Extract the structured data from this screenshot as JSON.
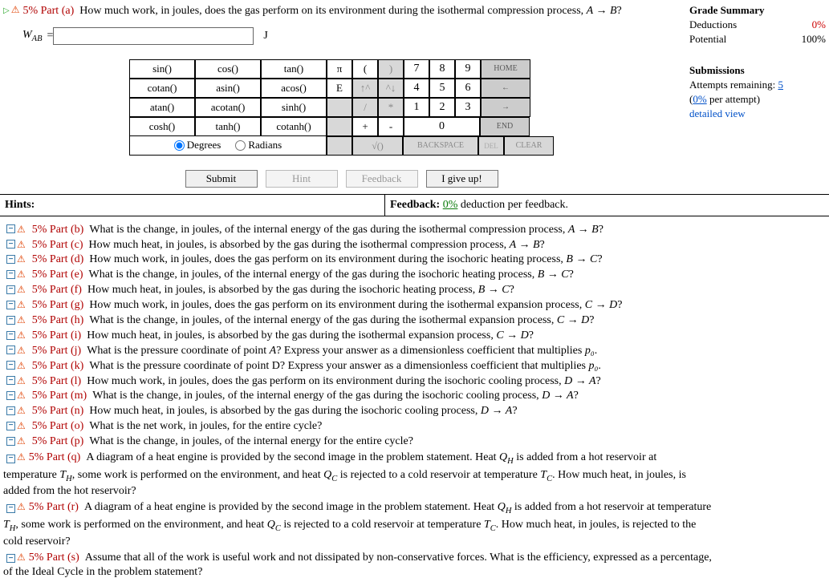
{
  "current": {
    "pct": "5%",
    "label": "Part (a)",
    "question_pre": "How much work, in joules, does the gas perform on its environment during the isothermal compression process, ",
    "process": "A → B",
    "question_post": "?",
    "answer_var_html": "W_{AB}",
    "equals": " = ",
    "unit": "J"
  },
  "summary": {
    "title": "Grade Summary",
    "deductions_label": "Deductions",
    "deductions_value": "0%",
    "potential_label": "Potential",
    "potential_value": "100%",
    "submissions_title": "Submissions",
    "attempts_label_pre": "Attempts remaining: ",
    "attempts_value": "5",
    "per_attempt": "(0% per attempt)",
    "detailed": "detailed view"
  },
  "keypad": {
    "funcs": [
      [
        "sin()",
        "cos()",
        "tan()"
      ],
      [
        "cotan()",
        "asin()",
        "acos()"
      ],
      [
        "atan()",
        "acotan()",
        "sinh()"
      ],
      [
        "cosh()",
        "tanh()",
        "cotanh()"
      ]
    ],
    "syms": [
      [
        "π",
        "(",
        ")"
      ],
      [
        "E",
        "↑^",
        "^↓"
      ],
      [
        "",
        "/",
        "*"
      ],
      [
        "",
        "+",
        "-"
      ],
      [
        "",
        "√()"
      ]
    ],
    "nums": [
      [
        "7",
        "8",
        "9"
      ],
      [
        "4",
        "5",
        "6"
      ],
      [
        "1",
        "2",
        "3"
      ]
    ],
    "zero": "0",
    "backspace": "BACKSPACE",
    "del": "DEL",
    "clear": "CLEAR",
    "rightcol": [
      "HOME",
      "←",
      "→",
      "END"
    ],
    "degrees": "Degrees",
    "radians": "Radians"
  },
  "actions": {
    "submit": "Submit",
    "hint": "Hint",
    "feedback": "Feedback",
    "giveup": "I give up!"
  },
  "hints": {
    "hints_label": "Hints:",
    "feedback_label": "Feedback: ",
    "feedback_pct": "0%",
    "feedback_post": " deduction per feedback."
  },
  "parts": [
    {
      "id": "b",
      "pct": "5%",
      "label": "Part (b)",
      "txt": "What is the change, in joules, of the internal energy of the gas during the isothermal compression process, ",
      "proc": "A → B",
      "post": "?"
    },
    {
      "id": "c",
      "pct": "5%",
      "label": "Part (c)",
      "txt": "How much heat, in joules, is absorbed by the gas during the isothermal compression process, ",
      "proc": "A → B",
      "post": "?"
    },
    {
      "id": "d",
      "pct": "5%",
      "label": "Part (d)",
      "txt": "How much work, in joules, does the gas perform on its environment during the isochoric heating process, ",
      "proc": "B → C",
      "post": "?"
    },
    {
      "id": "e",
      "pct": "5%",
      "label": "Part (e)",
      "txt": "What is the change, in joules, of the internal energy of the gas during the isochoric heating process, ",
      "proc": "B → C",
      "post": "?"
    },
    {
      "id": "f",
      "pct": "5%",
      "label": "Part (f)",
      "txt": "How much heat, in joules, is absorbed by the gas during the isochoric heating process, ",
      "proc": "B → C",
      "post": "?"
    },
    {
      "id": "g",
      "pct": "5%",
      "label": "Part (g)",
      "txt": "How much work, in joules, does the gas perform on its environment during the isothermal expansion process, ",
      "proc": "C → D",
      "post": "?"
    },
    {
      "id": "h",
      "pct": "5%",
      "label": "Part (h)",
      "txt": "What is the change, in joules, of the internal energy of the gas during the isothermal expansion process, ",
      "proc": "C → D",
      "post": "?"
    },
    {
      "id": "i",
      "pct": "5%",
      "label": "Part (i)",
      "txt": "How much heat, in joules, is absorbed by the gas during the isothermal expansion process, ",
      "proc": "C → D",
      "post": "?"
    },
    {
      "id": "j",
      "pct": "5%",
      "label": "Part (j)",
      "txt": "What is the pressure coordinate of point ",
      "proc": "A",
      "post": "? Express your answer as a dimensionless coefficient that multiplies ",
      "subvar": "p₀",
      "post2": "."
    },
    {
      "id": "k",
      "pct": "5%",
      "label": "Part (k)",
      "txt": "What is the pressure coordinate of point D? Express your answer as a dimensionless coefficient that multiplies ",
      "proc": "",
      "post": "",
      "subvar": "p₀",
      "post2": "."
    },
    {
      "id": "l",
      "pct": "5%",
      "label": "Part (l)",
      "txt": "How much work, in joules, does the gas perform on its environment during the isochoric cooling process, ",
      "proc": "D → A",
      "post": "?"
    },
    {
      "id": "m",
      "pct": "5%",
      "label": "Part (m)",
      "txt": "What is the change, in joules, of the internal energy of the gas during the isochoric cooling process, ",
      "proc": "D → A",
      "post": "?"
    },
    {
      "id": "n",
      "pct": "5%",
      "label": "Part (n)",
      "txt": "How much heat, in joules, is absorbed by the gas during the isochoric cooling process, ",
      "proc": "D → A",
      "post": "?"
    },
    {
      "id": "o",
      "pct": "5%",
      "label": "Part (o)",
      "txt": "What is the net work, in joules, for the entire cycle?",
      "proc": "",
      "post": ""
    },
    {
      "id": "p",
      "pct": "5%",
      "label": "Part (p)",
      "txt": "What is the change, in joules, of the internal energy for the entire cycle?",
      "proc": "",
      "post": ""
    }
  ],
  "longparts": [
    {
      "id": "q",
      "pct": "5%",
      "label": "Part (q)",
      "line1_pre": "A diagram of a heat engine is provided by the second image in the problem statement. Heat ",
      "var1": "Q_H",
      "line1_post": " is added from a hot reservoir at",
      "line2_pre": "temperature ",
      "var2": "T_H",
      "line2_mid": ", some work is performed on the environment, and heat ",
      "var3": "Q_C",
      "line2_mid2": " is rejected to a cold reservoir at temperature ",
      "var4": "T_C",
      "line2_end": ". How much heat, in joules, is",
      "line3": "added from the hot reservoir?"
    },
    {
      "id": "r",
      "pct": "5%",
      "label": "Part (r)",
      "line1_pre": "A diagram of a heat engine is provided by the second image in the problem statement. Heat ",
      "var1": "Q_H",
      "line1_post": " is added from a hot reservoir at temperature",
      "line2_prevar": "T_H",
      "line2_pre": ", some work is performed on the environment, and heat ",
      "var3": "Q_C",
      "line2_mid2": " is rejected to a cold reservoir at temperature ",
      "var4": "T_C",
      "line2_end": ". How much heat, in joules, is rejected to the",
      "line3": "cold reservoir?"
    },
    {
      "id": "s",
      "pct": "5%",
      "label": "Part (s)",
      "line1_pre": "Assume that all of the work is useful work and not dissipated by non-conservative forces. What is the efficiency, expressed as a percentage,",
      "line2": "of the Ideal Cycle in the problem statement?"
    }
  ]
}
